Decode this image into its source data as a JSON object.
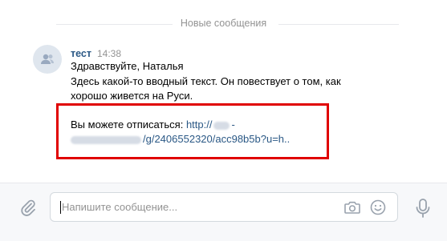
{
  "divider": {
    "label": "Новые сообщения"
  },
  "message": {
    "author": "тест",
    "time": "14:38",
    "greeting": "Здравствуйте, Наталья",
    "body_line1": "Здесь какой-то вводный текст. Он повествует о том, как",
    "body_line2": "хорошо живется на Руси.",
    "unsubscribe_label": "Вы можете отписаться:",
    "link_start": "http://",
    "link_mid": "-",
    "link_end": "/g/2406552320/acc98b5b?u=h..",
    "link_color": "#2a5885"
  },
  "highlight": {
    "color": "#e00000"
  },
  "composer": {
    "placeholder": "Напишите сообщение...",
    "value": "",
    "icons": [
      "paperclip-icon",
      "camera-icon",
      "smile-icon",
      "microphone-icon"
    ]
  }
}
